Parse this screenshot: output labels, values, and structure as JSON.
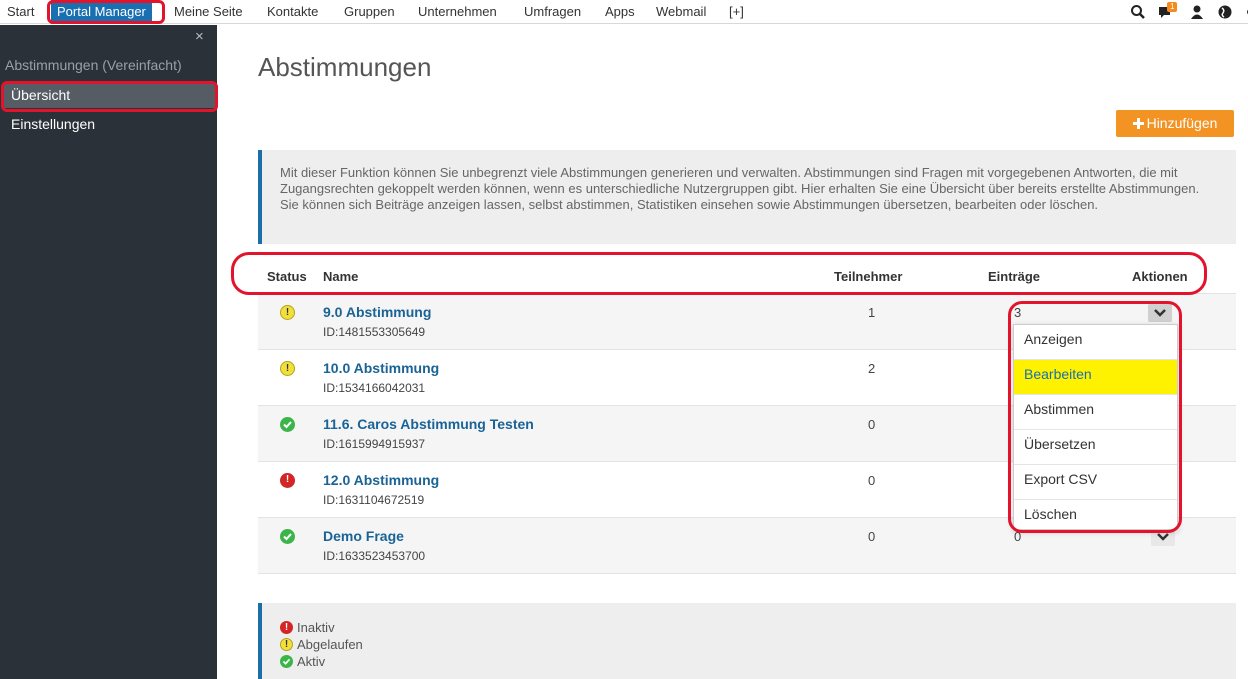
{
  "nav": {
    "items": [
      {
        "label": "Start"
      },
      {
        "label": "Portal Manager"
      },
      {
        "label": "Meine Seite"
      },
      {
        "label": "Kontakte"
      },
      {
        "label": "Gruppen"
      },
      {
        "label": "Unternehmen"
      },
      {
        "label": "Umfragen"
      },
      {
        "label": "Apps"
      },
      {
        "label": "Webmail"
      },
      {
        "label": "[+]"
      }
    ],
    "notification_count": "1",
    "icons": [
      "search-icon",
      "chat-icon",
      "user-icon",
      "globe-icon"
    ]
  },
  "sidebar": {
    "close": "×",
    "section_title": "Abstimmungen (Vereinfacht)",
    "items": [
      {
        "label": "Übersicht"
      },
      {
        "label": "Einstellungen"
      }
    ]
  },
  "page": {
    "title": "Abstimmungen",
    "add_button": "Hinzufügen",
    "info": "Mit dieser Funktion können Sie unbegrenzt viele Abstimmungen generieren und verwalten. Abstimmungen sind Fragen mit vorgegebenen Antworten, die mit Zugangsrechten gekoppelt werden können, wenn es unterschiedliche Nutzergruppen gibt. Hier erhalten Sie eine Übersicht über bereits erstellte Abstimmungen. Sie können sich Beiträge anzeigen lassen, selbst abstimmen, Statistiken einsehen sowie Abstimmungen übersetzen, bearbeiten oder löschen."
  },
  "table": {
    "headers": {
      "status": "Status",
      "name": "Name",
      "participants": "Teilnehmer",
      "entries": "Einträge",
      "actions": "Aktionen"
    },
    "rows": [
      {
        "status": "warning",
        "name": "9.0 Abstimmung",
        "id": "ID:1481553305649",
        "participants": "1",
        "entries": "3"
      },
      {
        "status": "warning",
        "name": "10.0 Abstimmung",
        "id": "ID:1534166042031",
        "participants": "2",
        "entries": ""
      },
      {
        "status": "active",
        "name": "11.6. Caros Abstimmung Testen",
        "id": "ID:1615994915937",
        "participants": "0",
        "entries": ""
      },
      {
        "status": "inactive",
        "name": "12.0 Abstimmung",
        "id": "ID:1631104672519",
        "participants": "0",
        "entries": ""
      },
      {
        "status": "active",
        "name": "Demo Frage",
        "id": "ID:1633523453700",
        "participants": "0",
        "entries": "0"
      }
    ]
  },
  "dropdown": {
    "items": [
      {
        "label": "Anzeigen"
      },
      {
        "label": "Bearbeiten"
      },
      {
        "label": "Abstimmen"
      },
      {
        "label": "Übersetzen"
      },
      {
        "label": "Export CSV"
      },
      {
        "label": "Löschen"
      }
    ]
  },
  "legend": {
    "inactive": "Inaktiv",
    "expired": "Abgelaufen",
    "active": "Aktiv"
  },
  "colors": {
    "accent": "#1a6fb0",
    "add_button": "#f39323",
    "highlight": "#fff200",
    "annotation": "#e2132b"
  }
}
